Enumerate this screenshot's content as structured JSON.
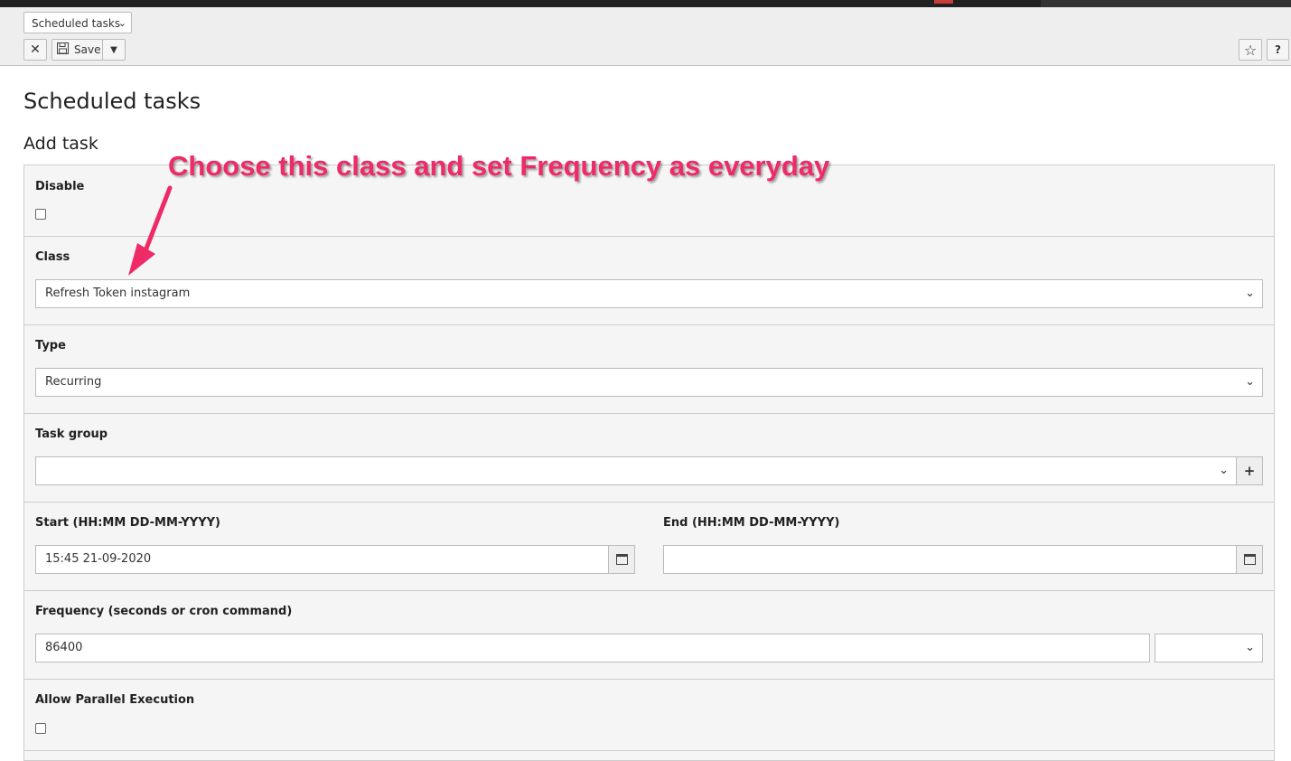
{
  "header": {
    "module_select": "Scheduled tasks",
    "save_label": "Save"
  },
  "page": {
    "title": "Scheduled tasks",
    "section": "Add task"
  },
  "form": {
    "disable_label": "Disable",
    "class_label": "Class",
    "class_value": "Refresh Token instagram",
    "type_label": "Type",
    "type_value": "Recurring",
    "task_group_label": "Task group",
    "task_group_value": "",
    "start_label": "Start (HH:MM DD-MM-YYYY)",
    "start_value": "15:45 21-09-2020",
    "end_label": "End (HH:MM DD-MM-YYYY)",
    "end_value": "",
    "frequency_label": "Frequency (seconds or cron command)",
    "frequency_value": "86400",
    "frequency_preset": "",
    "parallel_label": "Allow Parallel Execution"
  },
  "annotation": {
    "text": "Choose this class and set Frequency as everyday",
    "color": "#ee2a67"
  },
  "icons": [
    "close-icon",
    "save-icon",
    "caret-down-icon",
    "star-icon",
    "help-icon",
    "calendar-icon",
    "plus-icon",
    "chevron-down-icon"
  ]
}
